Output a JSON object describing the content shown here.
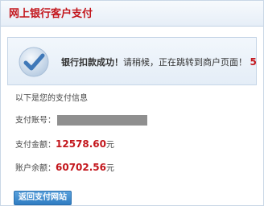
{
  "header": {
    "title": "网上银行客户支付"
  },
  "notice": {
    "strong_text": "银行扣款成功！",
    "message": "请稍候，正在跳转到商户页面！",
    "countdown": "5"
  },
  "info": {
    "title": "以下是您的支付信息",
    "account_label": "支付账号：",
    "amount_label": "支付金额：",
    "amount_value": "12578.60",
    "balance_label": "账户余额：",
    "balance_value": "60702.56",
    "currency": "元"
  },
  "actions": {
    "back_label": "返回支付网站"
  },
  "colors": {
    "accent_red": "#c3161c",
    "button_blue": "#2f7cc2"
  },
  "icons": {
    "success": "check-icon"
  }
}
